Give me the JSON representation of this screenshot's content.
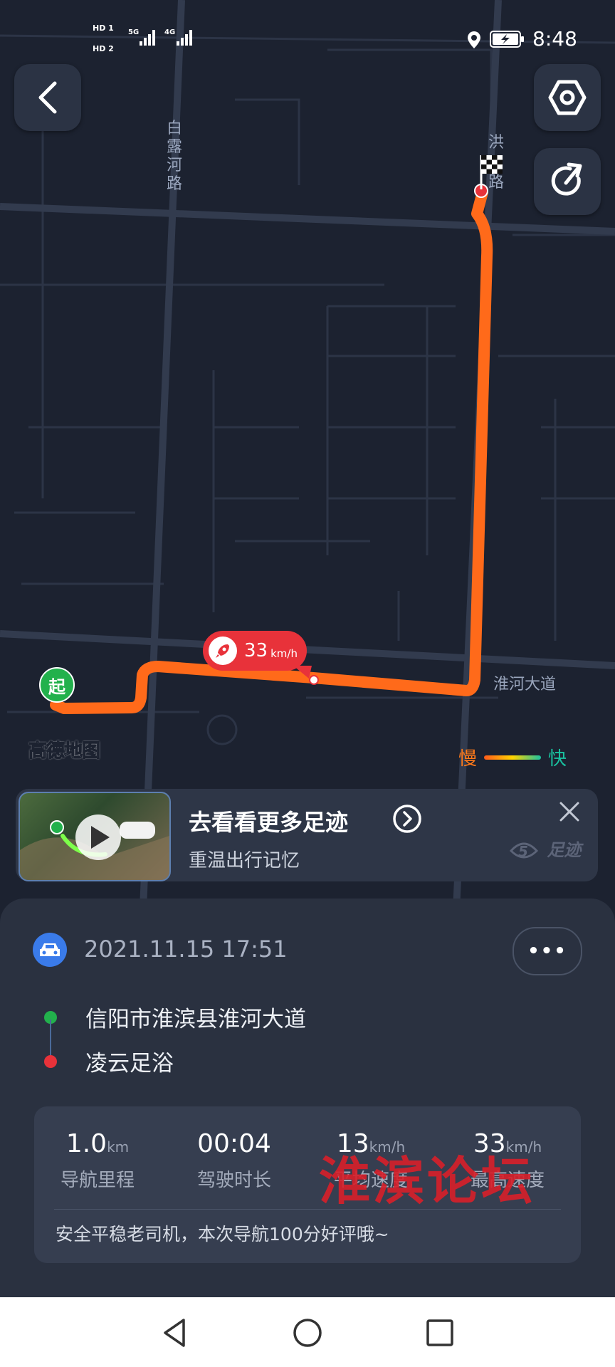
{
  "status_bar": {
    "sim1": "HD 1",
    "sim2": "HD 2",
    "net1": "5G",
    "net2": "4G",
    "time": "8:48"
  },
  "map": {
    "road_labels": {
      "bailuhe": "白露河路",
      "honglu_top": "洪",
      "honglu_bottom": "路",
      "huaihe": "淮河大道"
    },
    "speed_bubble": {
      "value": "33",
      "unit": "km/h"
    },
    "start_label": "起",
    "brand": "高德地图",
    "legend": {
      "slow": "慢",
      "fast": "快"
    }
  },
  "promo": {
    "title": "去看看更多足迹",
    "subtitle": "重温出行记忆",
    "logo_text": "足迹"
  },
  "trip": {
    "datetime": "2021.11.15 17:51",
    "more_label": "•••",
    "origin": "信阳市淮滨县淮河大道",
    "destination": "凌云足浴",
    "stats": [
      {
        "value": "1.0",
        "unit": "km",
        "label": "导航里程"
      },
      {
        "value": "00:04",
        "unit": "",
        "label": "驾驶时长"
      },
      {
        "value": "13",
        "unit": "km/h",
        "label": "平均速度"
      },
      {
        "value": "33",
        "unit": "km/h",
        "label": "最高速度"
      }
    ],
    "comment": "安全平稳老司机，本次导航100分好评哦~"
  },
  "watermark": "淮滨论坛",
  "colors": {
    "route": "#ff6a1a",
    "start": "#22b14c",
    "end": "#e8323a",
    "accent": "#3a7bea"
  }
}
